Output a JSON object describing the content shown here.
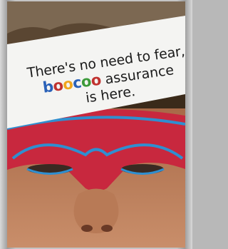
{
  "ad": {
    "line1": "There's no need to fear,",
    "brand_letters": [
      "b",
      "o",
      "o",
      "c",
      "o",
      "o"
    ],
    "line2_rest": "assurance",
    "line3": "is here."
  },
  "colors": {
    "brand_blue": "#2a61b8",
    "brand_red": "#c0322f",
    "brand_yellow": "#f0a51c",
    "brand_green": "#3c9a3a",
    "mask_red": "#c8283e",
    "mask_trim_blue": "#2f8fd0"
  }
}
